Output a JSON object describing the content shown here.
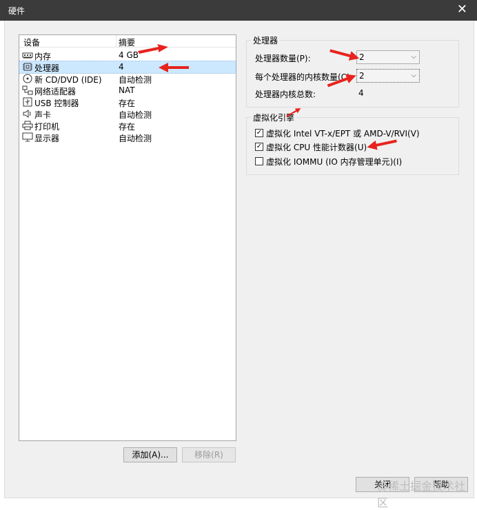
{
  "window": {
    "title": "硬件"
  },
  "devices": {
    "header_device": "设备",
    "header_summary": "摘要",
    "items": [
      {
        "name": "内存",
        "summary": "4 GB",
        "icon": "memory-icon"
      },
      {
        "name": "处理器",
        "summary": "4",
        "icon": "processor-icon"
      },
      {
        "name": "新 CD/DVD (IDE)",
        "summary": "自动检测",
        "icon": "cd-dvd-icon"
      },
      {
        "name": "网络适配器",
        "summary": "NAT",
        "icon": "network-icon"
      },
      {
        "name": "USB 控制器",
        "summary": "存在",
        "icon": "usb-icon"
      },
      {
        "name": "声卡",
        "summary": "自动检测",
        "icon": "sound-icon"
      },
      {
        "name": "打印机",
        "summary": "存在",
        "icon": "printer-icon"
      },
      {
        "name": "显示器",
        "summary": "自动检测",
        "icon": "display-icon"
      }
    ],
    "selected_index": 1
  },
  "buttons": {
    "add": "添加(A)...",
    "remove": "移除(R)",
    "close": "关闭",
    "help": "帮助"
  },
  "processor": {
    "group_label": "处理器",
    "count_label": "处理器数量(P):",
    "count_value": "2",
    "cores_label": "每个处理器的内核数量(C):",
    "cores_value": "2",
    "total_label": "处理器内核总数:",
    "total_value": "4"
  },
  "virtualization": {
    "group_label": "虚拟化引擎",
    "options": [
      {
        "label": "虚拟化 Intel VT-x/EPT 或 AMD-V/RVI(V)",
        "checked": true
      },
      {
        "label": "虚拟化 CPU 性能计数器(U)",
        "checked": true
      },
      {
        "label": "虚拟化 IOMMU (IO 内存管理单元)(I)",
        "checked": false
      }
    ]
  },
  "watermark": "@稀土掘金技术社区",
  "colors": {
    "titlebar": "#3b3b3b",
    "annotation_arrow": "#e8221d",
    "selection": "#cce8ff"
  }
}
